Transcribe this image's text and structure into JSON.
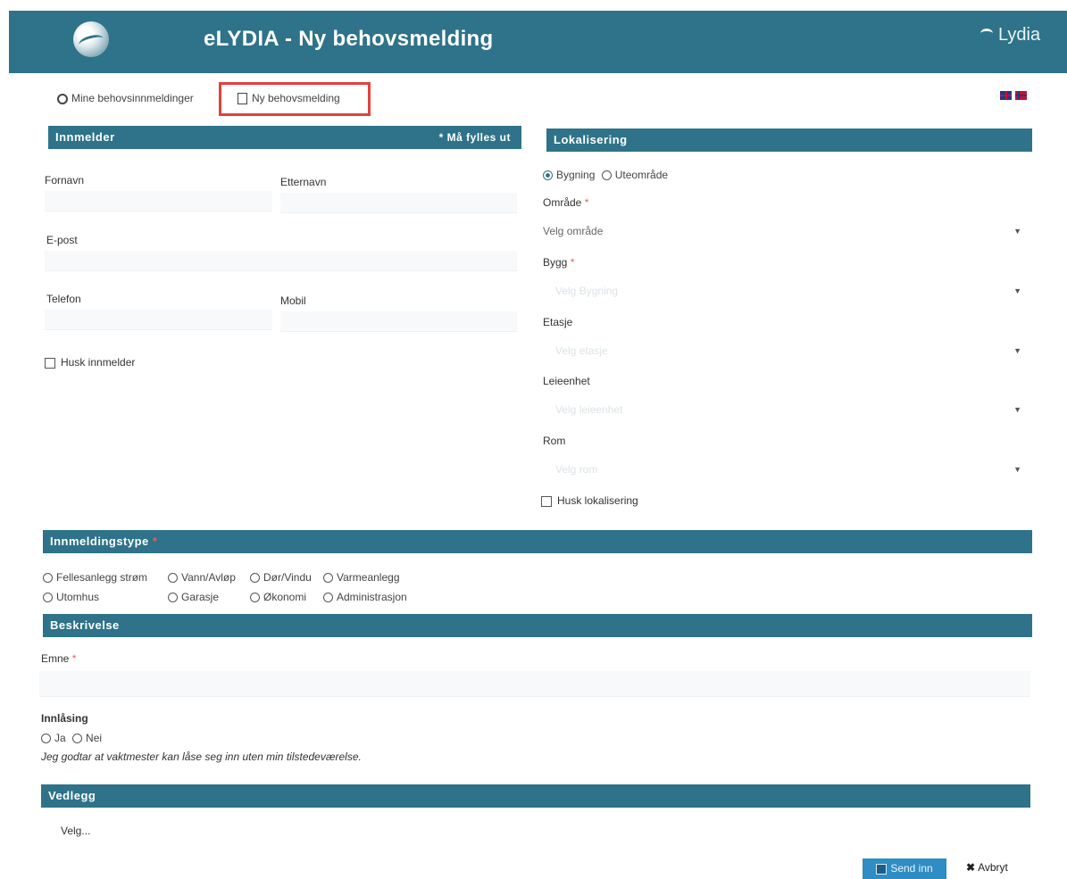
{
  "header": {
    "title": "eLYDIA - Ny behovsmelding",
    "brand": "Lydia"
  },
  "nav": {
    "my_reports": "Mine behovsinnmeldinger",
    "new_report": "Ny behovsmelding"
  },
  "reporter": {
    "section_title": "Innmelder",
    "required_note": "* Må fylles ut",
    "first_name_label": "Fornavn",
    "last_name_label": "Etternavn",
    "email_label": "E-post",
    "phone_label": "Telefon",
    "mobile_label": "Mobil",
    "remember_label": "Husk innmelder"
  },
  "location": {
    "section_title": "Lokalisering",
    "type_options": [
      "Bygning",
      "Uteområde"
    ],
    "selected_type": "Bygning",
    "area_label": "Område",
    "area_value": "Velg område",
    "building_label": "Bygg",
    "building_value": "Velg Bygning",
    "floor_label": "Etasje",
    "floor_value": "Velg etasje",
    "unit_label": "Leieenhet",
    "unit_value": "Velg leieenhet",
    "room_label": "Rom",
    "room_value": "Velg rom",
    "remember_label": "Husk lokalisering"
  },
  "report_type": {
    "section_title": "Innmeldingstype",
    "options": [
      "Fellesanlegg strøm",
      "Vann/Avløp",
      "Dør/Vindu",
      "Varmeanlegg",
      "Utomhus",
      "Garasje",
      "Økonomi",
      "Administrasjon"
    ]
  },
  "description": {
    "section_title": "Beskrivelse",
    "subject_label": "Emne"
  },
  "access": {
    "label": "Innlåsing",
    "yes": "Ja",
    "no": "Nei",
    "note": "Jeg godtar at vaktmester kan låse seg inn uten min tilstedeværelse."
  },
  "attachments": {
    "section_title": "Vedlegg",
    "choose_label": "Velg..."
  },
  "actions": {
    "send": "Send inn",
    "cancel": "Avbryt"
  },
  "colors": {
    "header": "#2e7389",
    "section_bar": "#2e7389",
    "highlight_border": "#e4413b",
    "send_button": "#2e8dc4",
    "required": "#e06060"
  }
}
